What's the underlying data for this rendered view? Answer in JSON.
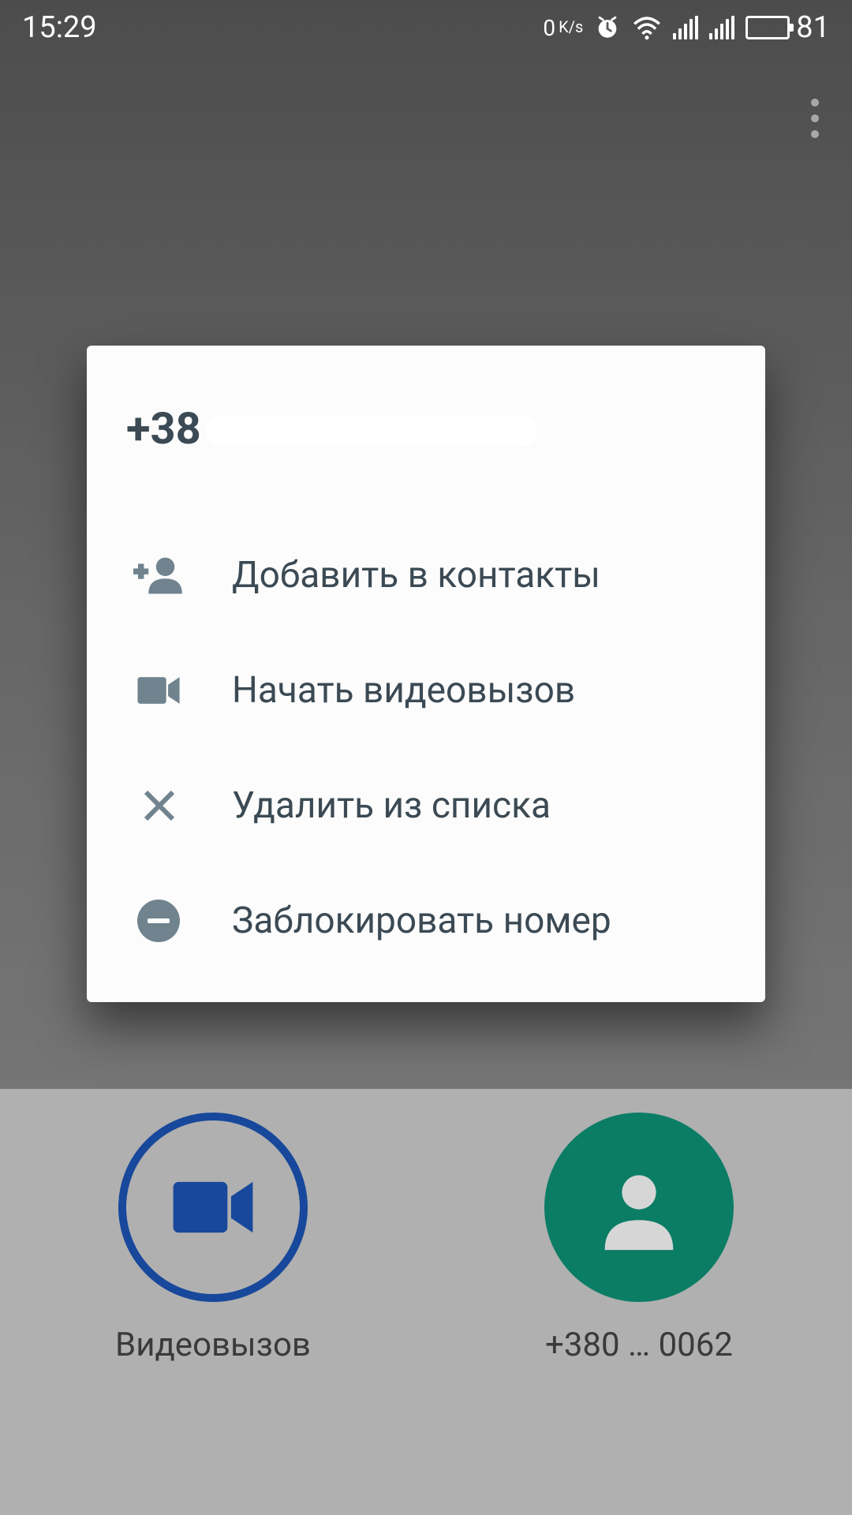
{
  "status": {
    "time": "15:29",
    "data_rate_value": "0",
    "data_rate_unit": "K/s",
    "battery_pct": "81"
  },
  "dialog": {
    "title_prefix": "+38",
    "items": [
      {
        "label": "Добавить в контакты"
      },
      {
        "label": "Начать видеовызов"
      },
      {
        "label": "Удалить из списка"
      },
      {
        "label": "Заблокировать номер"
      }
    ]
  },
  "contacts": {
    "left_label": "Видеовызов",
    "right_label": "+380 … 0062"
  }
}
